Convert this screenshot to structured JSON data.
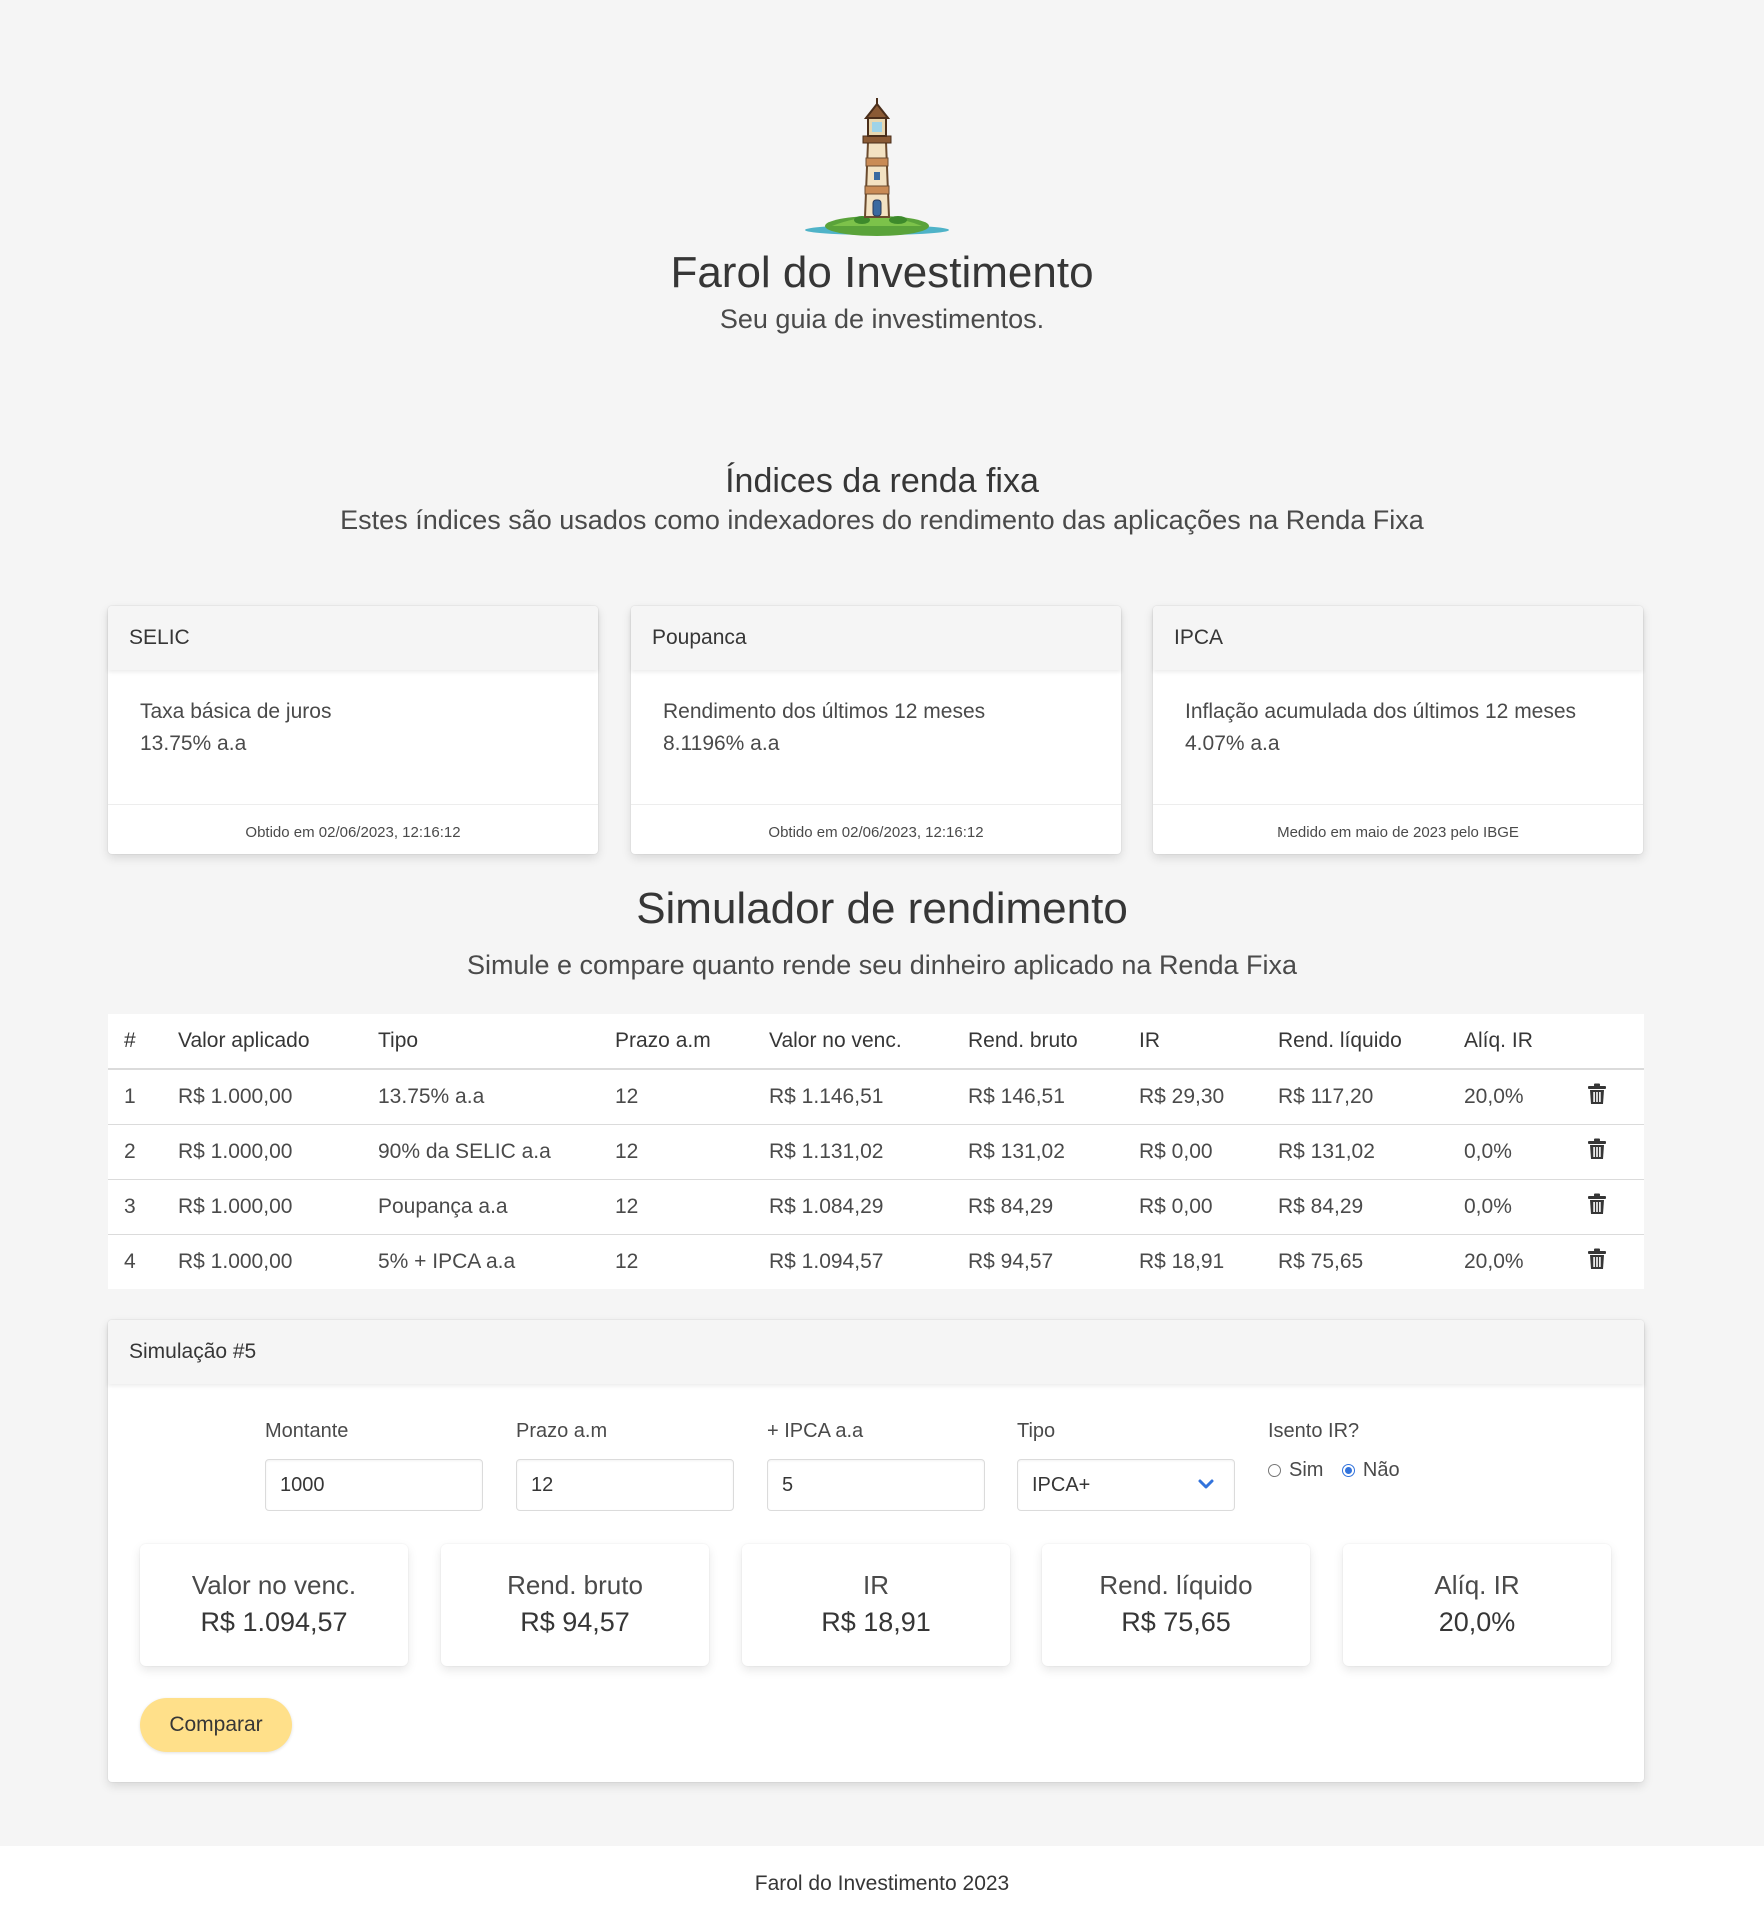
{
  "header": {
    "title": "Farol do Investimento",
    "subtitle": "Seu guia de investimentos.",
    "logo_icon": "lighthouse-icon"
  },
  "indices": {
    "title": "Índices da renda fixa",
    "subtitle": "Estes índices são usados como indexadores do rendimento das aplicações na Renda Fixa",
    "cards": [
      {
        "name": "SELIC",
        "description": "Taxa básica de juros",
        "value": "13.75% a.a",
        "footer": "Obtido em 02/06/2023, 12:16:12"
      },
      {
        "name": "Poupanca",
        "description": "Rendimento dos últimos 12 meses",
        "value": "8.1196% a.a",
        "footer": "Obtido em 02/06/2023, 12:16:12"
      },
      {
        "name": "IPCA",
        "description": "Inflação acumulada dos últimos 12 meses",
        "value": "4.07% a.a",
        "footer": "Medido em maio de 2023 pelo IBGE"
      }
    ]
  },
  "simulator": {
    "title": "Simulador de rendimento",
    "subtitle": "Simule e compare quanto rende seu dinheiro aplicado na Renda Fixa",
    "columns": [
      "#",
      "Valor aplicado",
      "Tipo",
      "Prazo a.m",
      "Valor no venc.",
      "Rend. bruto",
      "IR",
      "Rend. líquido",
      "Alíq. IR"
    ],
    "rows": [
      [
        "1",
        "R$ 1.000,00",
        "13.75% a.a",
        "12",
        "R$ 1.146,51",
        "R$ 146,51",
        "R$ 29,30",
        "R$ 117,20",
        "20,0%"
      ],
      [
        "2",
        "R$ 1.000,00",
        "90% da SELIC a.a",
        "12",
        "R$ 1.131,02",
        "R$ 131,02",
        "R$ 0,00",
        "R$ 131,02",
        "0,0%"
      ],
      [
        "3",
        "R$ 1.000,00",
        "Poupança a.a",
        "12",
        "R$ 1.084,29",
        "R$ 84,29",
        "R$ 0,00",
        "R$ 84,29",
        "0,0%"
      ],
      [
        "4",
        "R$ 1.000,00",
        "5% + IPCA a.a",
        "12",
        "R$ 1.094,57",
        "R$ 94,57",
        "R$ 18,91",
        "R$ 75,65",
        "20,0%"
      ]
    ],
    "delete_icon": "trash-icon"
  },
  "simulation": {
    "title": "Simulação #5",
    "fields": {
      "montante": {
        "label": "Montante",
        "value": "1000"
      },
      "prazo": {
        "label": "Prazo a.m",
        "value": "12"
      },
      "ipca": {
        "label": "+ IPCA a.a",
        "value": "5"
      },
      "tipo": {
        "label": "Tipo",
        "value": "IPCA+"
      }
    },
    "isento": {
      "label": "Isento IR?",
      "options": [
        "Sim",
        "Não"
      ],
      "selected": "Não"
    },
    "results": [
      {
        "label": "Valor no venc.",
        "value": "R$ 1.094,57"
      },
      {
        "label": "Rend. bruto",
        "value": "R$ 94,57"
      },
      {
        "label": "IR",
        "value": "R$ 18,91"
      },
      {
        "label": "Rend. líquido",
        "value": "R$ 75,65"
      },
      {
        "label": "Alíq. IR",
        "value": "20,0%"
      }
    ],
    "compare_label": "Comparar"
  },
  "footer": {
    "text": "Farol do Investimento 2023"
  },
  "colors": {
    "accent": "#3273dc",
    "button": "#ffe08a",
    "background": "#f5f5f5"
  }
}
